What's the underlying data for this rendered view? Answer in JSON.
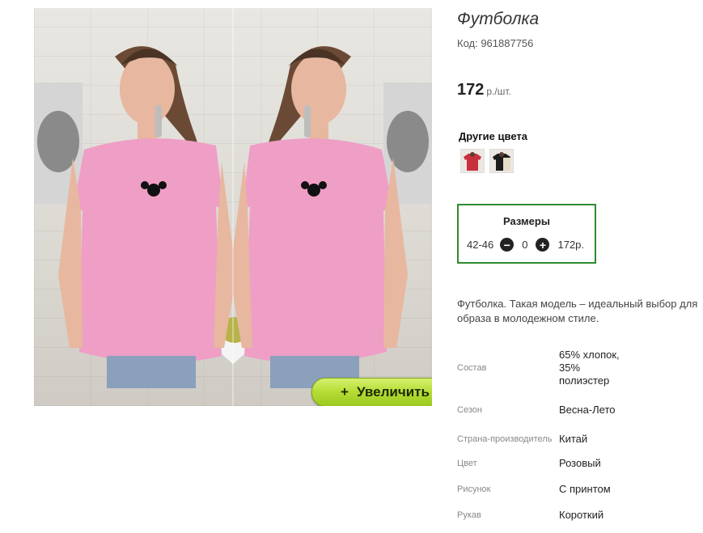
{
  "product": {
    "title": "Футболка",
    "code": "Код: 961887756",
    "price": "172",
    "price_unit": "р./шт.",
    "zoom_label": "Увеличить",
    "zoom_icon": "+"
  },
  "other_colors": {
    "title": "Другие цвета",
    "swatches": [
      {
        "icon": "red-tshirt-thumbnail",
        "color": "#c8303e"
      },
      {
        "icon": "black-tshirt-thumbnail",
        "color": "#1c1c1c"
      }
    ]
  },
  "sizes": {
    "title": "Размеры",
    "size": "42-46",
    "quantity": "0",
    "price": "172р."
  },
  "description": "Футболка. Такая модель – идеальный выбор для образа в молодежном стиле.",
  "specs": [
    {
      "key": "Состав",
      "value": "65% хлопок, 35% полиэстер"
    },
    {
      "key": "Сезон",
      "value": "Весна-Лето"
    },
    {
      "key": "Страна-производитель",
      "value": "Китай"
    },
    {
      "key": "Цвет",
      "value": "Розовый"
    },
    {
      "key": "Рисунок",
      "value": "С принтом"
    },
    {
      "key": "Рукав",
      "value": "Короткий"
    }
  ],
  "colors": {
    "accent_green": "#2e8b2e",
    "zoom_button": "#b4dc34",
    "tshirt_pink": "#ef9ec6"
  }
}
